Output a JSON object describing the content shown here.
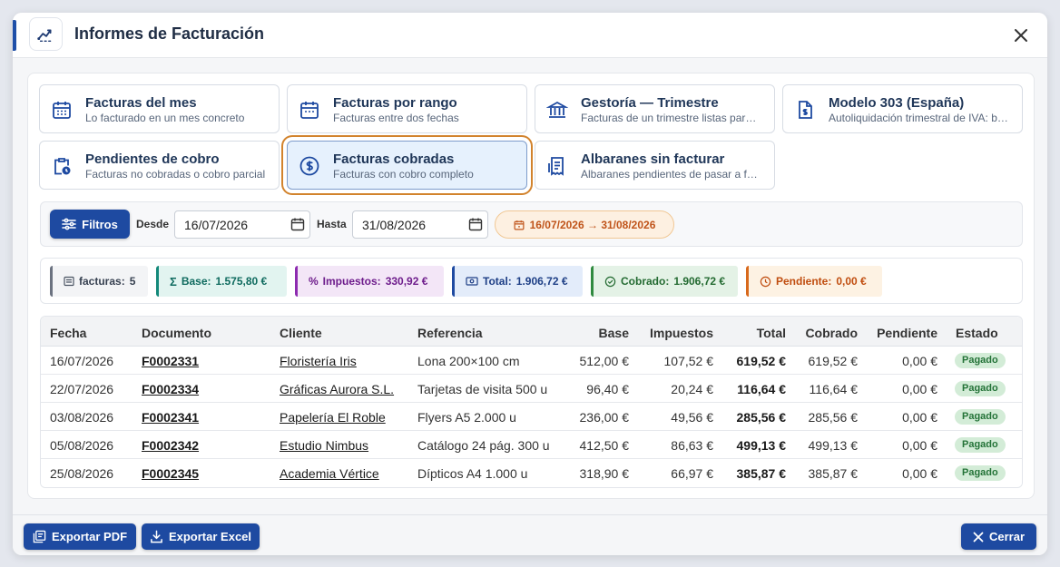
{
  "header": {
    "title": "Informes de Facturación"
  },
  "report_cards": [
    {
      "title": "Facturas del mes",
      "subtitle": "Lo facturado en un mes concreto",
      "icon": "calendar-grid-icon"
    },
    {
      "title": "Facturas por rango",
      "subtitle": "Facturas entre dos fechas",
      "icon": "calendar-icon"
    },
    {
      "title": "Gestoría — Trimestre",
      "subtitle": "Facturas de un trimestre listas para …",
      "icon": "bank-icon"
    },
    {
      "title": "Modelo 303 (España)",
      "subtitle": "Autoliquidación trimestral de IVA: b…",
      "icon": "document-dollar-icon"
    },
    {
      "title": "Pendientes de cobro",
      "subtitle": "Facturas no cobradas o cobro parcial",
      "icon": "clipboard-clock-icon"
    },
    {
      "title": "Facturas cobradas",
      "subtitle": "Facturas con cobro completo",
      "icon": "dollar-circle-icon",
      "active": true
    },
    {
      "title": "Albaranes sin facturar",
      "subtitle": "Albaranes pendientes de pasar a fa…",
      "icon": "receipt-icon"
    }
  ],
  "filters": {
    "button_label": "Filtros",
    "desde_label": "Desde",
    "desde_value": "16/07/2026",
    "hasta_label": "Hasta",
    "hasta_value": "31/08/2026",
    "range_chip": "16/07/2026 → 31/08/2026"
  },
  "summary": {
    "facturas_label": "facturas:",
    "facturas_value": "5",
    "base_label": "Base:",
    "base_value": "1.575,80 €",
    "impuestos_label": "Impuestos:",
    "impuestos_value": "330,92 €",
    "total_label": "Total:",
    "total_value": "1.906,72 €",
    "cobrado_label": "Cobrado:",
    "cobrado_value": "1.906,72 €",
    "pendiente_label": "Pendiente:",
    "pendiente_value": "0,00 €"
  },
  "table": {
    "columns": [
      "Fecha",
      "Documento",
      "Cliente",
      "Referencia",
      "Base",
      "Impuestos",
      "Total",
      "Cobrado",
      "Pendiente",
      "Estado"
    ],
    "rows": [
      [
        "16/07/2026",
        "F0002331",
        "Floristería Iris",
        "Lona 200×100 cm",
        "512,00 €",
        "107,52 €",
        "619,52 €",
        "619,52 €",
        "0,00 €",
        "Pagado"
      ],
      [
        "22/07/2026",
        "F0002334",
        "Gráficas Aurora S.L.",
        "Tarjetas de visita 500 u",
        "96,40 €",
        "20,24 €",
        "116,64 €",
        "116,64 €",
        "0,00 €",
        "Pagado"
      ],
      [
        "03/08/2026",
        "F0002341",
        "Papelería El Roble",
        "Flyers A5 2.000 u",
        "236,00 €",
        "49,56 €",
        "285,56 €",
        "285,56 €",
        "0,00 €",
        "Pagado"
      ],
      [
        "05/08/2026",
        "F0002342",
        "Estudio Nimbus",
        "Catálogo 24 pág. 300 u",
        "412,50 €",
        "86,63 €",
        "499,13 €",
        "499,13 €",
        "0,00 €",
        "Pagado"
      ],
      [
        "25/08/2026",
        "F0002345",
        "Academia Vértice",
        "Dípticos A4 1.000 u",
        "318,90 €",
        "66,97 €",
        "385,87 €",
        "385,87 €",
        "0,00 €",
        "Pagado"
      ]
    ]
  },
  "footer": {
    "export_pdf": "Exportar PDF",
    "export_excel": "Exportar Excel",
    "close": "Cerrar"
  },
  "colors": {
    "primary": "#1e4aa1",
    "active_card_outline": "#d2832d",
    "paid_badge_bg": "#d3ecd7",
    "paid_badge_text": "#247338"
  }
}
